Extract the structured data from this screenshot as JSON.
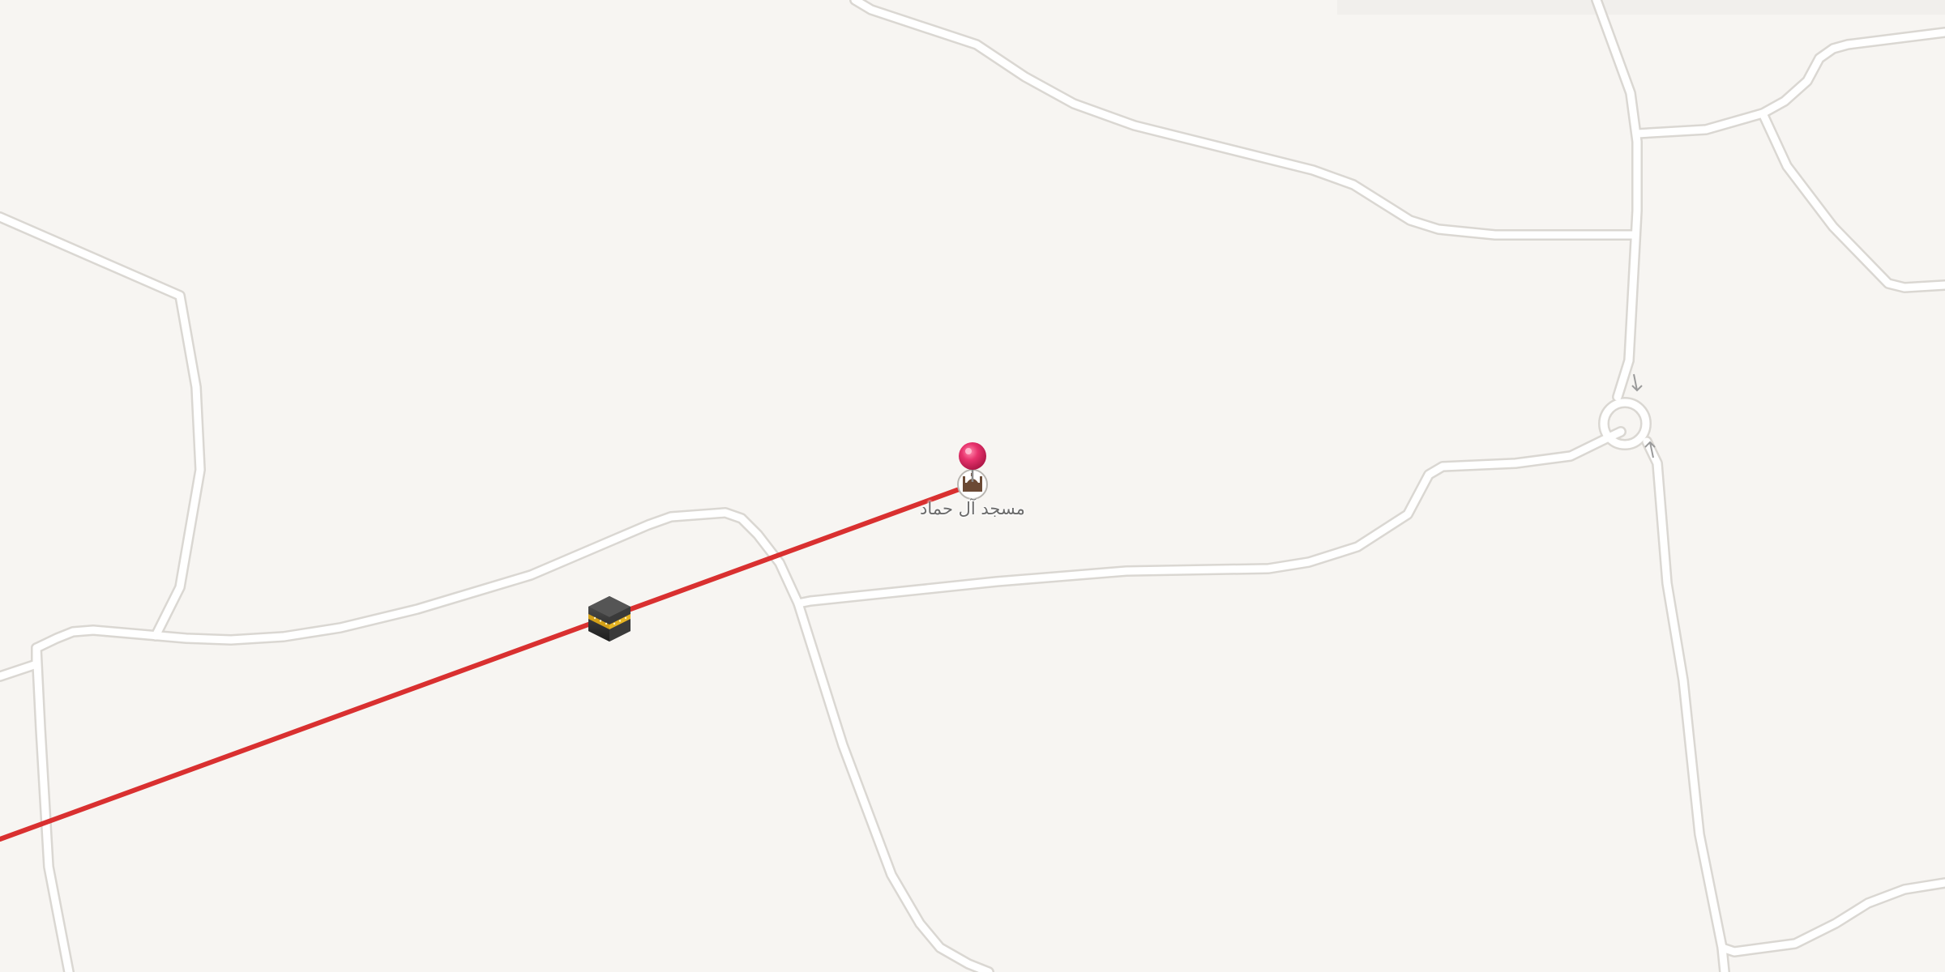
{
  "map": {
    "poi": {
      "name": "مسجد آل حماد",
      "icon": "mosque-icon",
      "pin_icon": "pin-icon",
      "pin_color": "#e8336d"
    },
    "qibla": {
      "icon": "kaaba-icon",
      "line_color": "#d93030"
    },
    "colors": {
      "background": "#f7f5f2",
      "road": "#ffffff",
      "road_casing": "#dad7d2"
    }
  }
}
